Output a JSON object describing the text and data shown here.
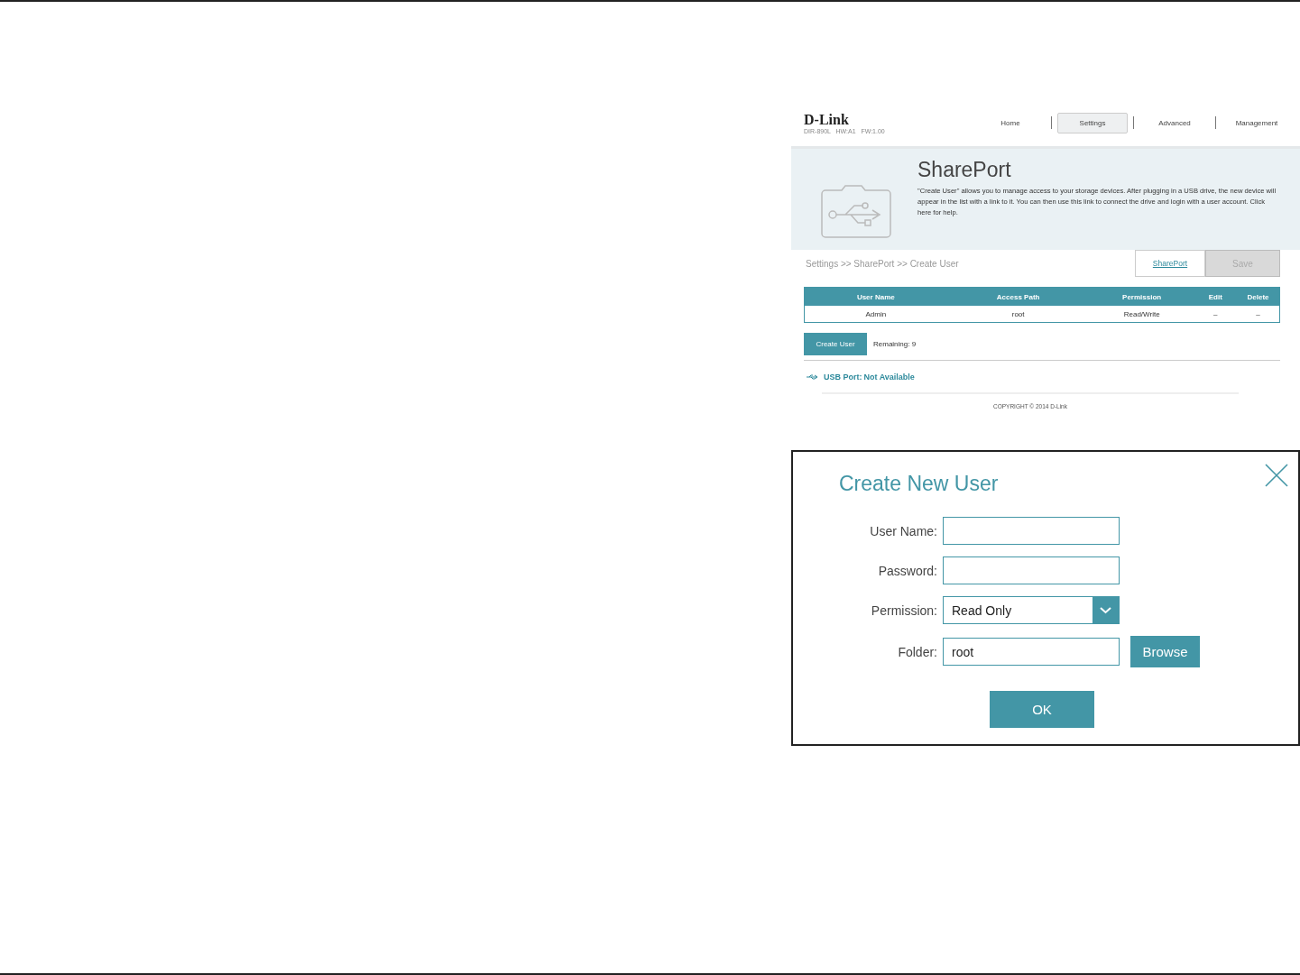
{
  "header": {
    "logo": "D-Link",
    "model": "DIR-890L   HW:A1   FW:1.00"
  },
  "nav": [
    {
      "label": "Home",
      "selected": false
    },
    {
      "label": "Settings",
      "selected": true
    },
    {
      "label": "Advanced",
      "selected": false
    },
    {
      "label": "Management",
      "selected": false
    }
  ],
  "banner": {
    "title": "SharePort",
    "description": "\"Create User\" allows you to manage access to your storage devices. After plugging in a USB drive, the new device will appear in the list with a link to it. You can then use this link to connect the drive and login with a user account. Click here for help."
  },
  "breadcrumb": "Settings >> SharePort >> Create User",
  "link_button": "SharePort",
  "save_button": {
    "label": "Save",
    "disabled": true
  },
  "table": {
    "columns": [
      "User Name",
      "Access Path",
      "Permission",
      "Edit",
      "Delete"
    ],
    "rows": [
      [
        "Admin",
        "root",
        "Read/Write",
        "–",
        "–"
      ]
    ]
  },
  "create_button": "Create User",
  "remaining": "Remaining: 9",
  "usb": {
    "label": "USB Port:",
    "value": "Not Available"
  },
  "copyright": "COPYRIGHT © 2014 D-Link",
  "dialog": {
    "title": "Create New User",
    "fields": [
      {
        "kind": "text",
        "label": "User Name:"
      },
      {
        "kind": "password",
        "label": "Password:"
      },
      {
        "kind": "select",
        "label": "Permission:",
        "value": "Read Only"
      },
      {
        "kind": "browse",
        "label": "Folder:",
        "value": "root",
        "button": "Browse"
      }
    ],
    "ok": "OK"
  }
}
